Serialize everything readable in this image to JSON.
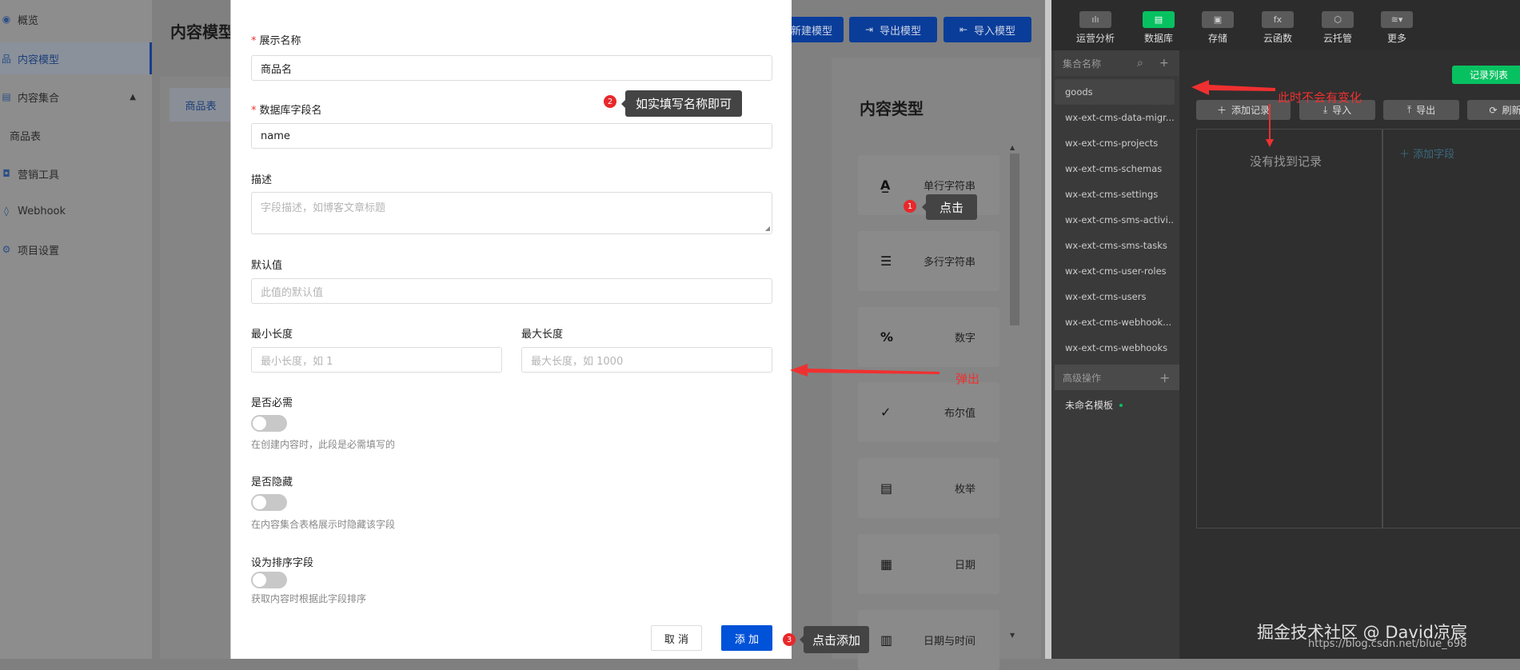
{
  "cms": {
    "sidebar": {
      "items": [
        {
          "label": "概览",
          "icon": "eye-icon"
        },
        {
          "label": "内容模型",
          "icon": "model-icon",
          "active": true
        },
        {
          "label": "内容集合",
          "icon": "collection-icon"
        },
        {
          "label": "商品表"
        },
        {
          "label": "营销工具",
          "icon": "bag-icon"
        },
        {
          "label": "Webhook",
          "icon": "webhook-icon"
        },
        {
          "label": "项目设置",
          "icon": "gear-icon"
        }
      ]
    },
    "page_title": "内容模型",
    "tab": "商品表",
    "buttons": {
      "new_model": "新建模型",
      "export_model": "导出模型",
      "import_model": "导入模型"
    },
    "types_title": "内容类型",
    "types": [
      "单行字符串",
      "多行字符串",
      "数字",
      "布尔值",
      "枚举",
      "日期",
      "日期与时间"
    ]
  },
  "dialog": {
    "display_name": {
      "label": "展示名称",
      "value": "商品名"
    },
    "db_field": {
      "label": "数据库字段名",
      "value": "name"
    },
    "description": {
      "label": "描述",
      "placeholder": "字段描述，如博客文章标题"
    },
    "default_value": {
      "label": "默认值",
      "placeholder": "此值的默认值"
    },
    "min_length": {
      "label": "最小长度",
      "placeholder": "最小长度，如 1"
    },
    "max_length": {
      "label": "最大长度",
      "placeholder": "最大长度，如 1000"
    },
    "required": {
      "label": "是否必需",
      "help": "在创建内容时，此段是必需填写的",
      "on": false
    },
    "hidden": {
      "label": "是否隐藏",
      "help": "在内容集合表格展示时隐藏该字段",
      "on": false
    },
    "sort": {
      "label": "设为排序字段",
      "help": "获取内容时根据此字段排序",
      "on": false
    },
    "cancel": "取 消",
    "add": "添 加"
  },
  "devtools": {
    "toolbar": [
      {
        "label": "运营分析",
        "icon": "chart-icon"
      },
      {
        "label": "数据库",
        "icon": "database-icon",
        "active": true
      },
      {
        "label": "存储",
        "icon": "storage-icon"
      },
      {
        "label": "云函数",
        "icon": "function-icon"
      },
      {
        "label": "云托管",
        "icon": "cube-icon"
      },
      {
        "label": "更多",
        "icon": "layers-icon"
      }
    ],
    "collections_header": "集合名称",
    "collections": [
      "goods",
      "wx-ext-cms-data-migr...",
      "wx-ext-cms-projects",
      "wx-ext-cms-schemas",
      "wx-ext-cms-settings",
      "wx-ext-cms-sms-activi...",
      "wx-ext-cms-sms-tasks",
      "wx-ext-cms-user-roles",
      "wx-ext-cms-users",
      "wx-ext-cms-webhook...",
      "wx-ext-cms-webhooks"
    ],
    "advanced_header": "高级操作",
    "template": "未命名模板",
    "record_list": "记录列表",
    "actions": {
      "add_record": "添加记录",
      "import": "导入",
      "export": "导出",
      "refresh": "刷新"
    },
    "empty": "没有找到记录",
    "add_field": "添加字段",
    "accent": "#07c160"
  },
  "annotations": {
    "step1": {
      "num": "1",
      "text": "点击"
    },
    "step2": {
      "num": "2",
      "text": "如实填写名称即可"
    },
    "step3": {
      "num": "3",
      "text": "点击添加"
    },
    "popup": "弹出",
    "no_change": "此时不会有变化"
  },
  "watermark": {
    "line1": "掘金技术社区 @ David凉宸",
    "line2": "https://blog.csdn.net/blue_698"
  }
}
